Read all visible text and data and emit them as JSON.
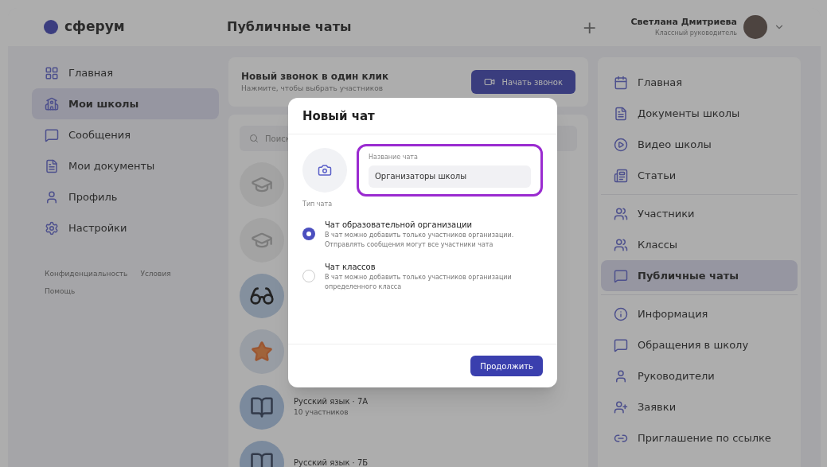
{
  "header": {
    "logo": "сферум",
    "title": "Публичные чаты",
    "add": "+",
    "user_name": "Светлана Дмитриева",
    "user_role": "Классный руководитель"
  },
  "left_nav": {
    "items": [
      {
        "label": "Главная",
        "selected": false
      },
      {
        "label": "Мои школы",
        "selected": true
      },
      {
        "label": "Сообщения",
        "selected": false
      },
      {
        "label": "Мои документы",
        "selected": false
      },
      {
        "label": "Профиль",
        "selected": false
      },
      {
        "label": "Настройки",
        "selected": false
      }
    ],
    "footer_links": [
      "Конфиденциальность",
      "Условия",
      "Помощь"
    ]
  },
  "call_banner": {
    "title": "Новый звонок в один клик",
    "subtitle": "Нажмите, чтобы выбрать участников",
    "button": "Начать звонок"
  },
  "search": {
    "placeholder": "Поиск"
  },
  "chats": [
    {
      "name": "Русский язык · 7А",
      "members": "10 участников"
    },
    {
      "name": "Русский язык · 7Б"
    }
  ],
  "right_nav": {
    "groups": [
      [
        {
          "label": "Главная",
          "selected": false
        },
        {
          "label": "Документы школы",
          "selected": false
        },
        {
          "label": "Видео школы",
          "selected": false
        },
        {
          "label": "Статьи",
          "selected": false
        }
      ],
      [
        {
          "label": "Участники",
          "selected": false
        },
        {
          "label": "Классы",
          "selected": false
        },
        {
          "label": "Публичные чаты",
          "selected": true
        }
      ],
      [
        {
          "label": "Информация",
          "selected": false
        },
        {
          "label": "Обращения в школу",
          "selected": false
        },
        {
          "label": "Руководители",
          "selected": false
        },
        {
          "label": "Заявки",
          "selected": false
        },
        {
          "label": "Приглашение по ссылке",
          "selected": false
        }
      ]
    ]
  },
  "dialog": {
    "title": "Новый чат",
    "name_label": "Название чата",
    "name_value": "Организаторы школы",
    "highlighted": true,
    "type_label": "Тип чата",
    "options": [
      {
        "title": "Чат образовательной организации",
        "description": "В чат можно добавить только участников организации. Отправлять сообщения могут все участники чата",
        "selected": true
      },
      {
        "title": "Чат классов",
        "description": "В чат можно добавить только участников организации определенного класса",
        "selected": false
      }
    ],
    "button": "Продолжить"
  }
}
